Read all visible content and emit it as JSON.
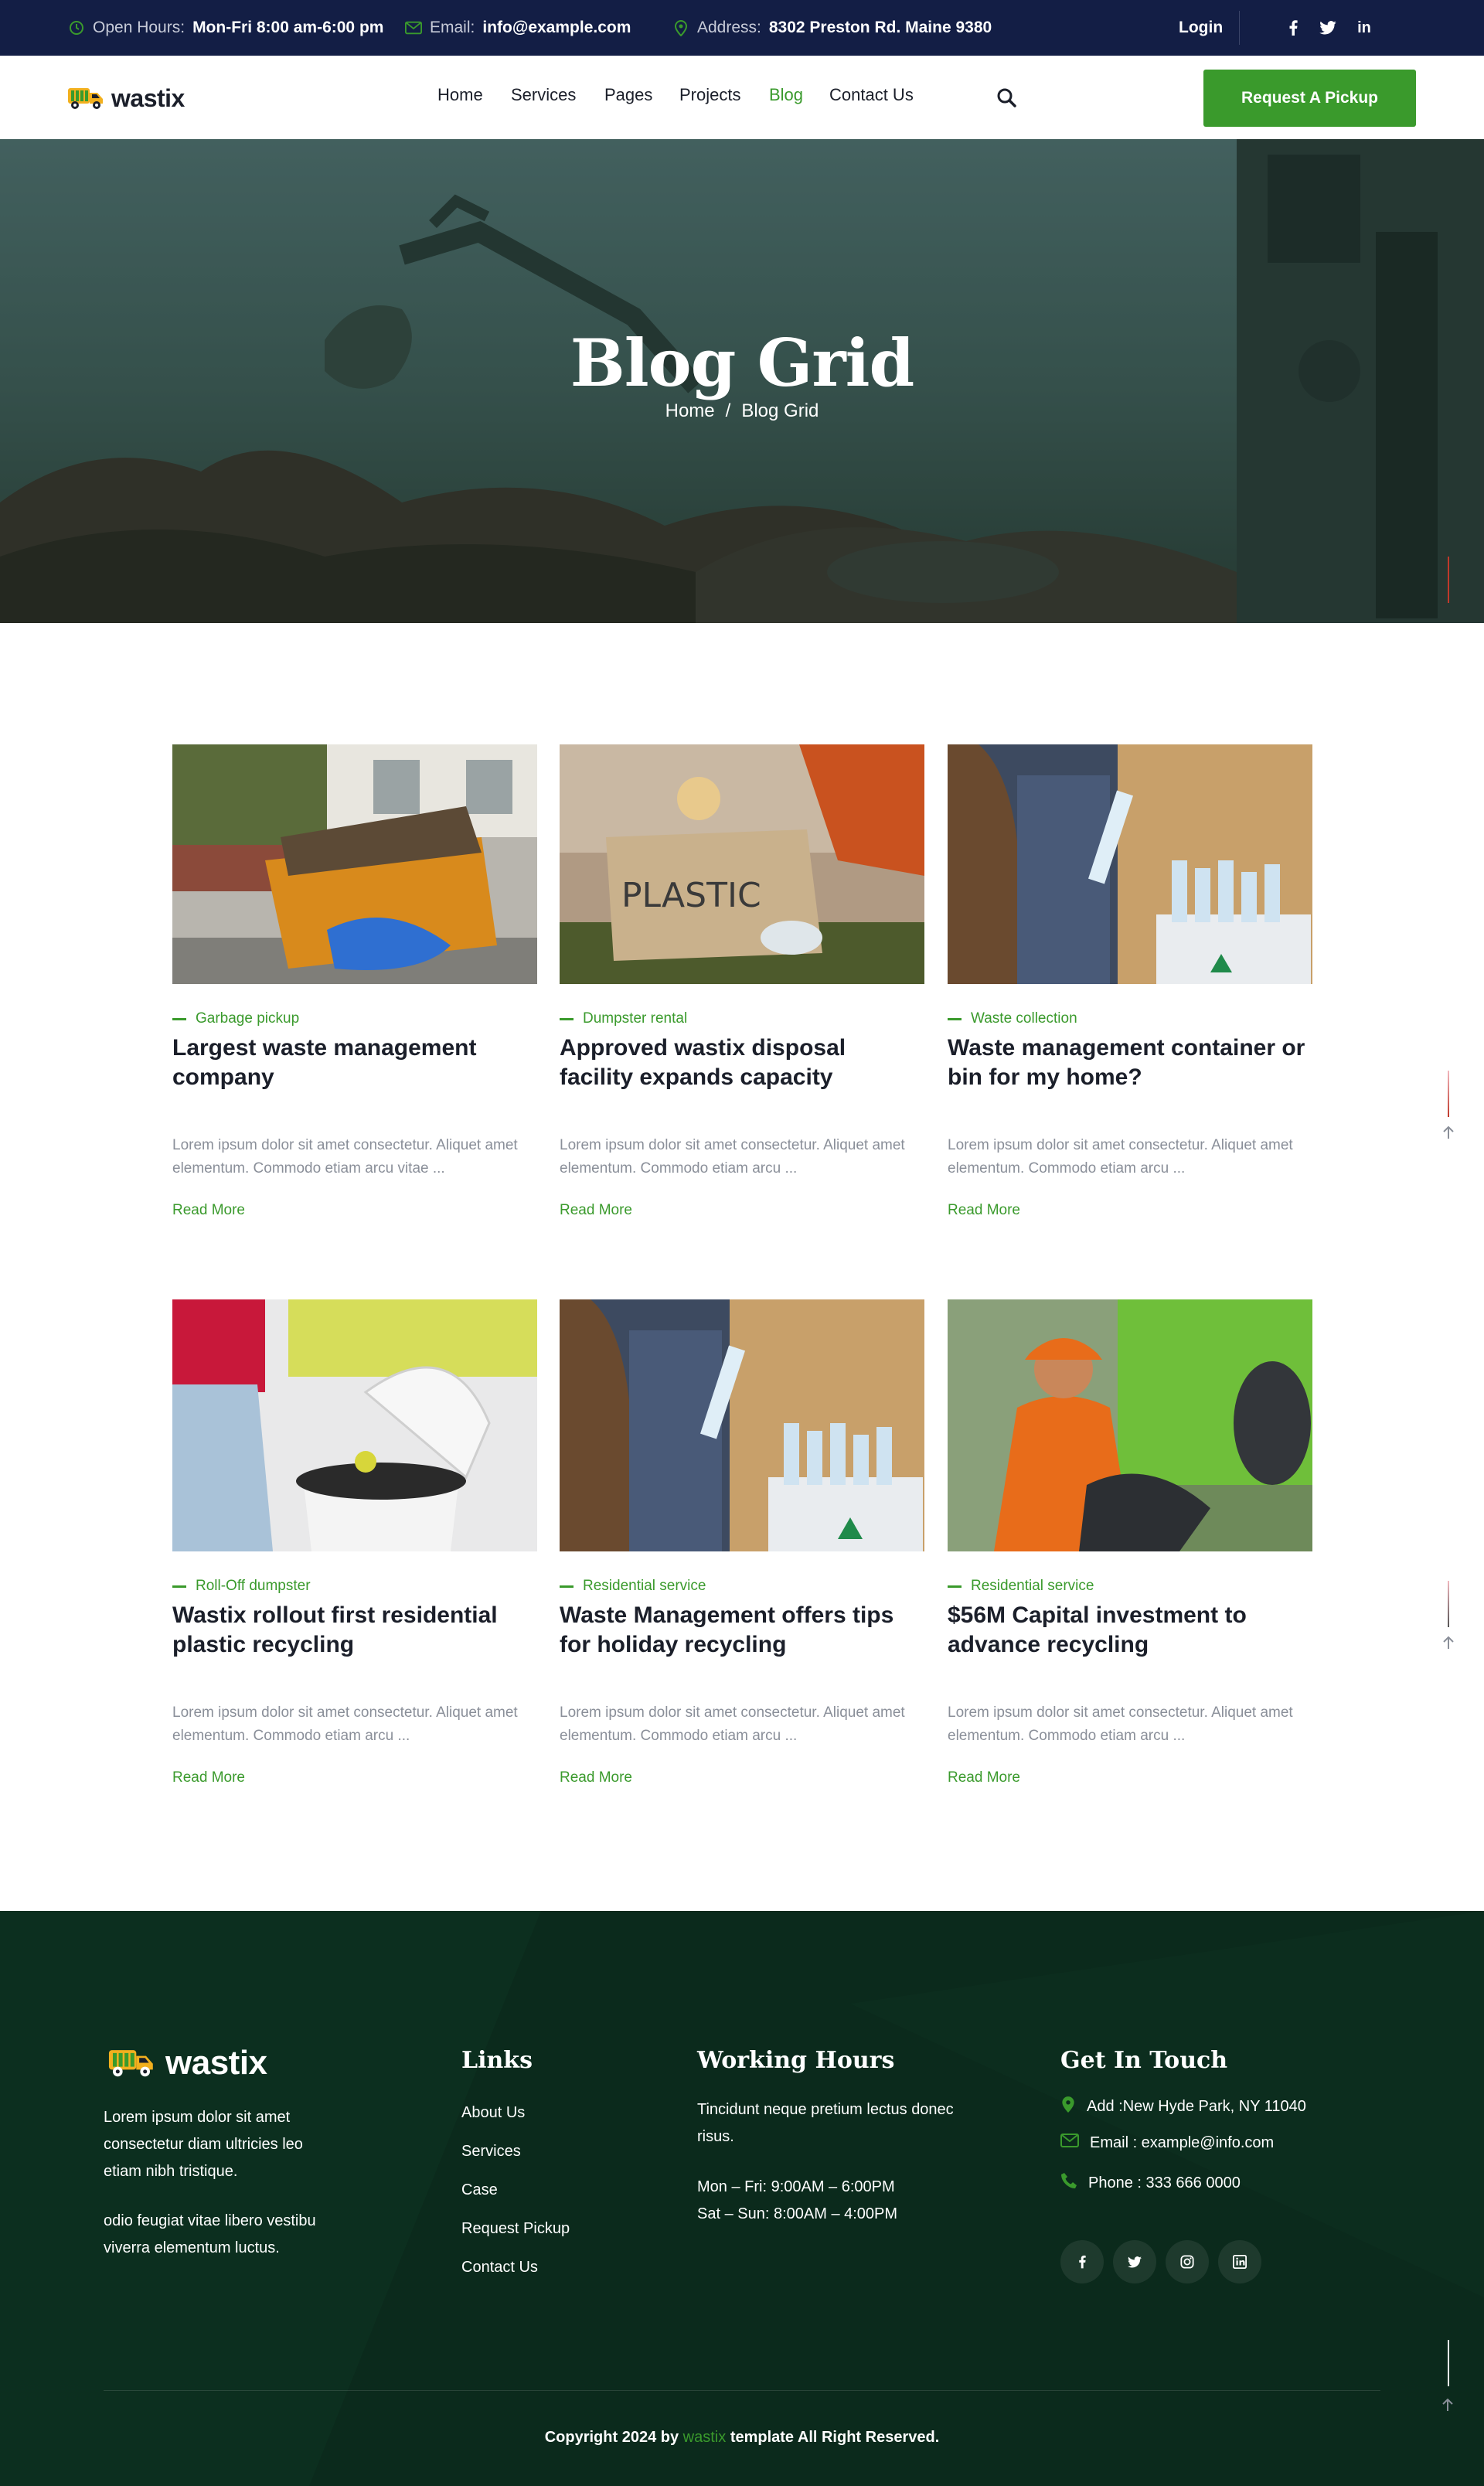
{
  "topbar": {
    "hours_label": "Open Hours:",
    "hours_value": "Mon-Fri 8:00 am-6:00 pm",
    "email_label": "Email:",
    "email_value": "info@example.com",
    "address_label": "Address:",
    "address_value": "8302 Preston Rd. Maine 9380",
    "login": "Login",
    "social": [
      "f",
      "t",
      "in"
    ]
  },
  "header": {
    "logo_text": "wastix",
    "nav": [
      "Home",
      "Services",
      "Pages",
      "Projects",
      "Blog",
      "Contact Us"
    ],
    "active_nav": "Blog",
    "cta": "Request A Pickup"
  },
  "hero": {
    "title": "Blog Grid",
    "breadcrumb_home": "Home",
    "breadcrumb_sep": "/",
    "breadcrumb_current": "Blog Grid"
  },
  "posts": [
    {
      "category": "Garbage pickup",
      "title": "Largest waste management company",
      "excerpt": "Lorem ipsum dolor sit amet consectetur. Aliquet amet elementum. Commodo etiam arcu vitae ...",
      "more": "Read More"
    },
    {
      "category": "Dumpster rental",
      "title": "Approved wastix disposal facility expands capacity",
      "excerpt": "Lorem ipsum dolor sit amet consectetur. Aliquet amet elementum. Commodo etiam arcu ...",
      "more": "Read More"
    },
    {
      "category": "Waste collection",
      "title": "Waste management container or bin for my home?",
      "excerpt": "Lorem ipsum dolor sit amet consectetur. Aliquet amet elementum. Commodo etiam arcu ...",
      "more": "Read More"
    },
    {
      "category": "Roll-Off dumpster",
      "title": "Wastix rollout first residential plastic recycling",
      "excerpt": "Lorem ipsum dolor sit amet consectetur. Aliquet amet elementum. Commodo etiam arcu ...",
      "more": "Read More"
    },
    {
      "category": "Residential service",
      "title": "Waste Management offers tips for holiday recycling",
      "excerpt": "Lorem ipsum dolor sit amet consectetur. Aliquet amet elementum. Commodo etiam arcu ...",
      "more": "Read More"
    },
    {
      "category": "Residential service",
      "title": "$56M Capital investment to advance recycling",
      "excerpt": "Lorem ipsum dolor sit amet consectetur. Aliquet amet elementum. Commodo etiam arcu ...",
      "more": "Read More"
    }
  ],
  "footer": {
    "logo_text": "wastix",
    "about_1": "Lorem ipsum dolor sit amet consectetur diam ultricies leo etiam nibh tristique.",
    "about_2": "odio feugiat vitae libero vestibu viverra elementum luctus.",
    "links_heading": "Links",
    "links": [
      "About Us",
      "Services",
      "Case",
      "Request Pickup",
      "Contact Us"
    ],
    "hours_heading": "Working Hours",
    "hours_intro": "Tincidunt neque pretium lectus donec risus.",
    "hours_weekday": "Mon – Fri: 9:00AM – 6:00PM",
    "hours_weekend": "Sat – Sun: 8:00AM – 4:00PM",
    "contact_heading": "Get In Touch",
    "contact_address": "Add :New Hyde Park, NY 11040",
    "contact_email": "Email : example@info.com",
    "contact_phone": "Phone : 333 666 0000",
    "social": [
      "f",
      "t",
      "ig",
      "in"
    ],
    "copyright_prefix": "Copyright 2024 by",
    "copyright_brand": "wastix",
    "copyright_suffix": "template All Right Reserved."
  },
  "colors": {
    "topbar_bg": "#131e45",
    "accent_green": "#3a9a2c",
    "footer_bg": "#0b2a1c",
    "text_dark": "#1b1f2a",
    "text_muted": "#8a8f99"
  },
  "icons": [
    "clock-icon",
    "mail-icon",
    "location-icon",
    "facebook-icon",
    "twitter-icon",
    "linkedin-icon",
    "search-icon",
    "truck-logo-icon",
    "phone-icon",
    "instagram-icon",
    "arrow-up-icon"
  ]
}
